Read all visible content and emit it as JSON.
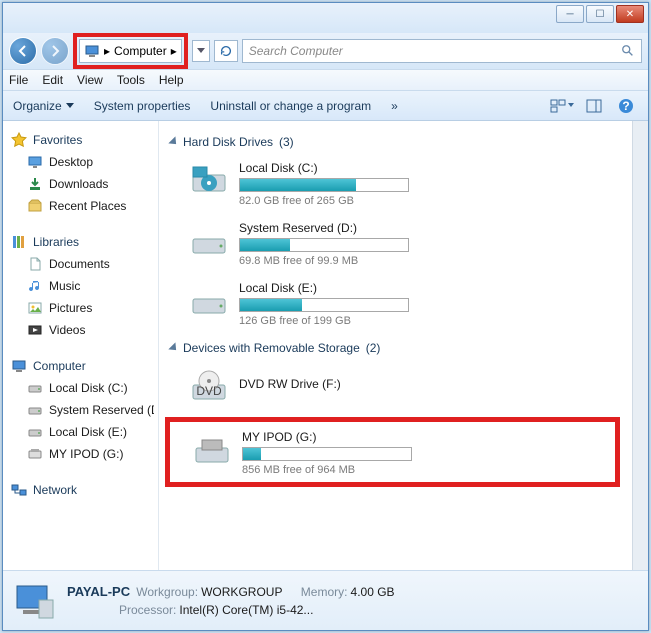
{
  "title": "Computer",
  "address": {
    "location": "Computer"
  },
  "search": {
    "placeholder": "Search Computer"
  },
  "menu": {
    "file": "File",
    "edit": "Edit",
    "view": "View",
    "tools": "Tools",
    "help": "Help"
  },
  "toolbar": {
    "organize": "Organize",
    "sys_props": "System properties",
    "uninstall": "Uninstall or change a program",
    "more": "»"
  },
  "sidebar": {
    "favorites": {
      "label": "Favorites",
      "items": [
        "Desktop",
        "Downloads",
        "Recent Places"
      ]
    },
    "libraries": {
      "label": "Libraries",
      "items": [
        "Documents",
        "Music",
        "Pictures",
        "Videos"
      ]
    },
    "computer": {
      "label": "Computer",
      "items": [
        "Local Disk (C:)",
        "System Reserved (D:)",
        "Local Disk (E:)",
        "MY IPOD (G:)"
      ]
    },
    "network": {
      "label": "Network"
    }
  },
  "sections": {
    "hdd": {
      "title": "Hard Disk Drives",
      "count": "(3)"
    },
    "rem": {
      "title": "Devices with Removable Storage",
      "count": "(2)"
    }
  },
  "drives": {
    "c": {
      "name": "Local Disk (C:)",
      "free": "82.0 GB free of 265 GB",
      "pct": 69
    },
    "d": {
      "name": "System Reserved (D:)",
      "free": "69.8 MB free of 99.9 MB",
      "pct": 30
    },
    "e": {
      "name": "Local Disk (E:)",
      "free": "126 GB free of 199 GB",
      "pct": 37
    },
    "dvd": {
      "name": "DVD RW Drive (F:)"
    },
    "g": {
      "name": "MY IPOD (G:)",
      "free": "856 MB free of 964 MB",
      "pct": 11
    }
  },
  "details": {
    "name": "PAYAL-PC",
    "workgroup_lbl": "Workgroup:",
    "workgroup": "WORKGROUP",
    "processor_lbl": "Processor:",
    "processor": "Intel(R) Core(TM) i5-42...",
    "memory_lbl": "Memory:",
    "memory": "4.00 GB"
  },
  "colors": {
    "annot": "#e02020"
  }
}
